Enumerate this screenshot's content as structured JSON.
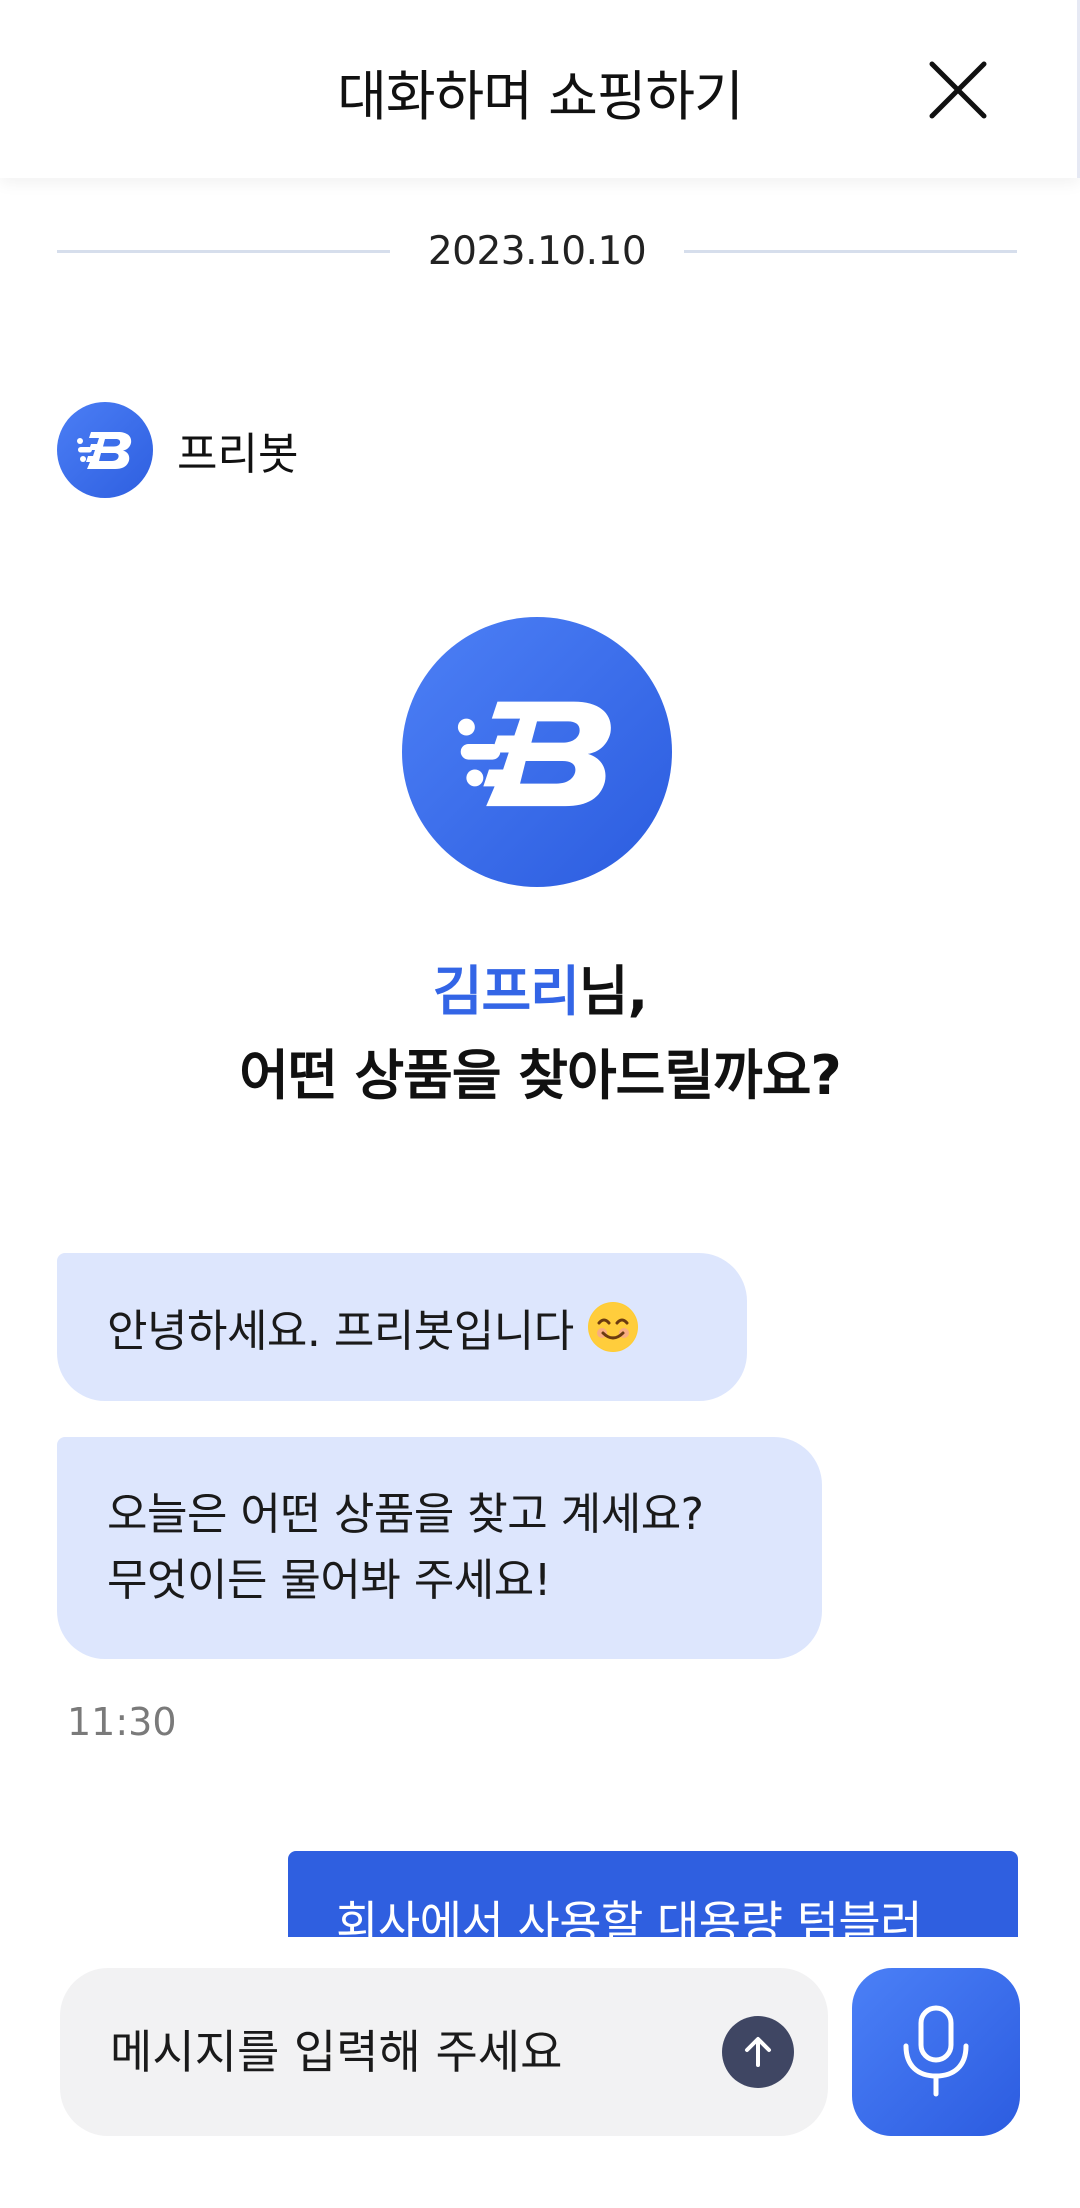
{
  "header": {
    "title": "대화하며 쇼핑하기",
    "close_icon": "close-icon"
  },
  "chat": {
    "date": "2023.10.10",
    "bot_name": "프리봇",
    "greeting": {
      "user_name": "김프리",
      "suffix": "님,",
      "question": "어떤 상품을 찾아드릴까요?"
    },
    "messages": [
      {
        "text": "안녕하세요. 프리봇입니다",
        "emoji": "smiling-face-icon"
      },
      {
        "lines": [
          "오늘은 어떤 상품을 찾고 계세요?",
          "무엇이든 물어봐 주세요!"
        ]
      }
    ],
    "time": "11:30",
    "user_message": "회사에서 사용할 대용량 텀블러"
  },
  "input": {
    "placeholder": "메시지를 입력해 주세요",
    "send_icon": "arrow-up-icon",
    "mic_icon": "microphone-icon"
  },
  "colors": {
    "brand_blue": "#3365e6",
    "bot_bubble": "#dde6fd",
    "user_bubble": "#2f5fe0",
    "send_button": "#3f4663"
  }
}
